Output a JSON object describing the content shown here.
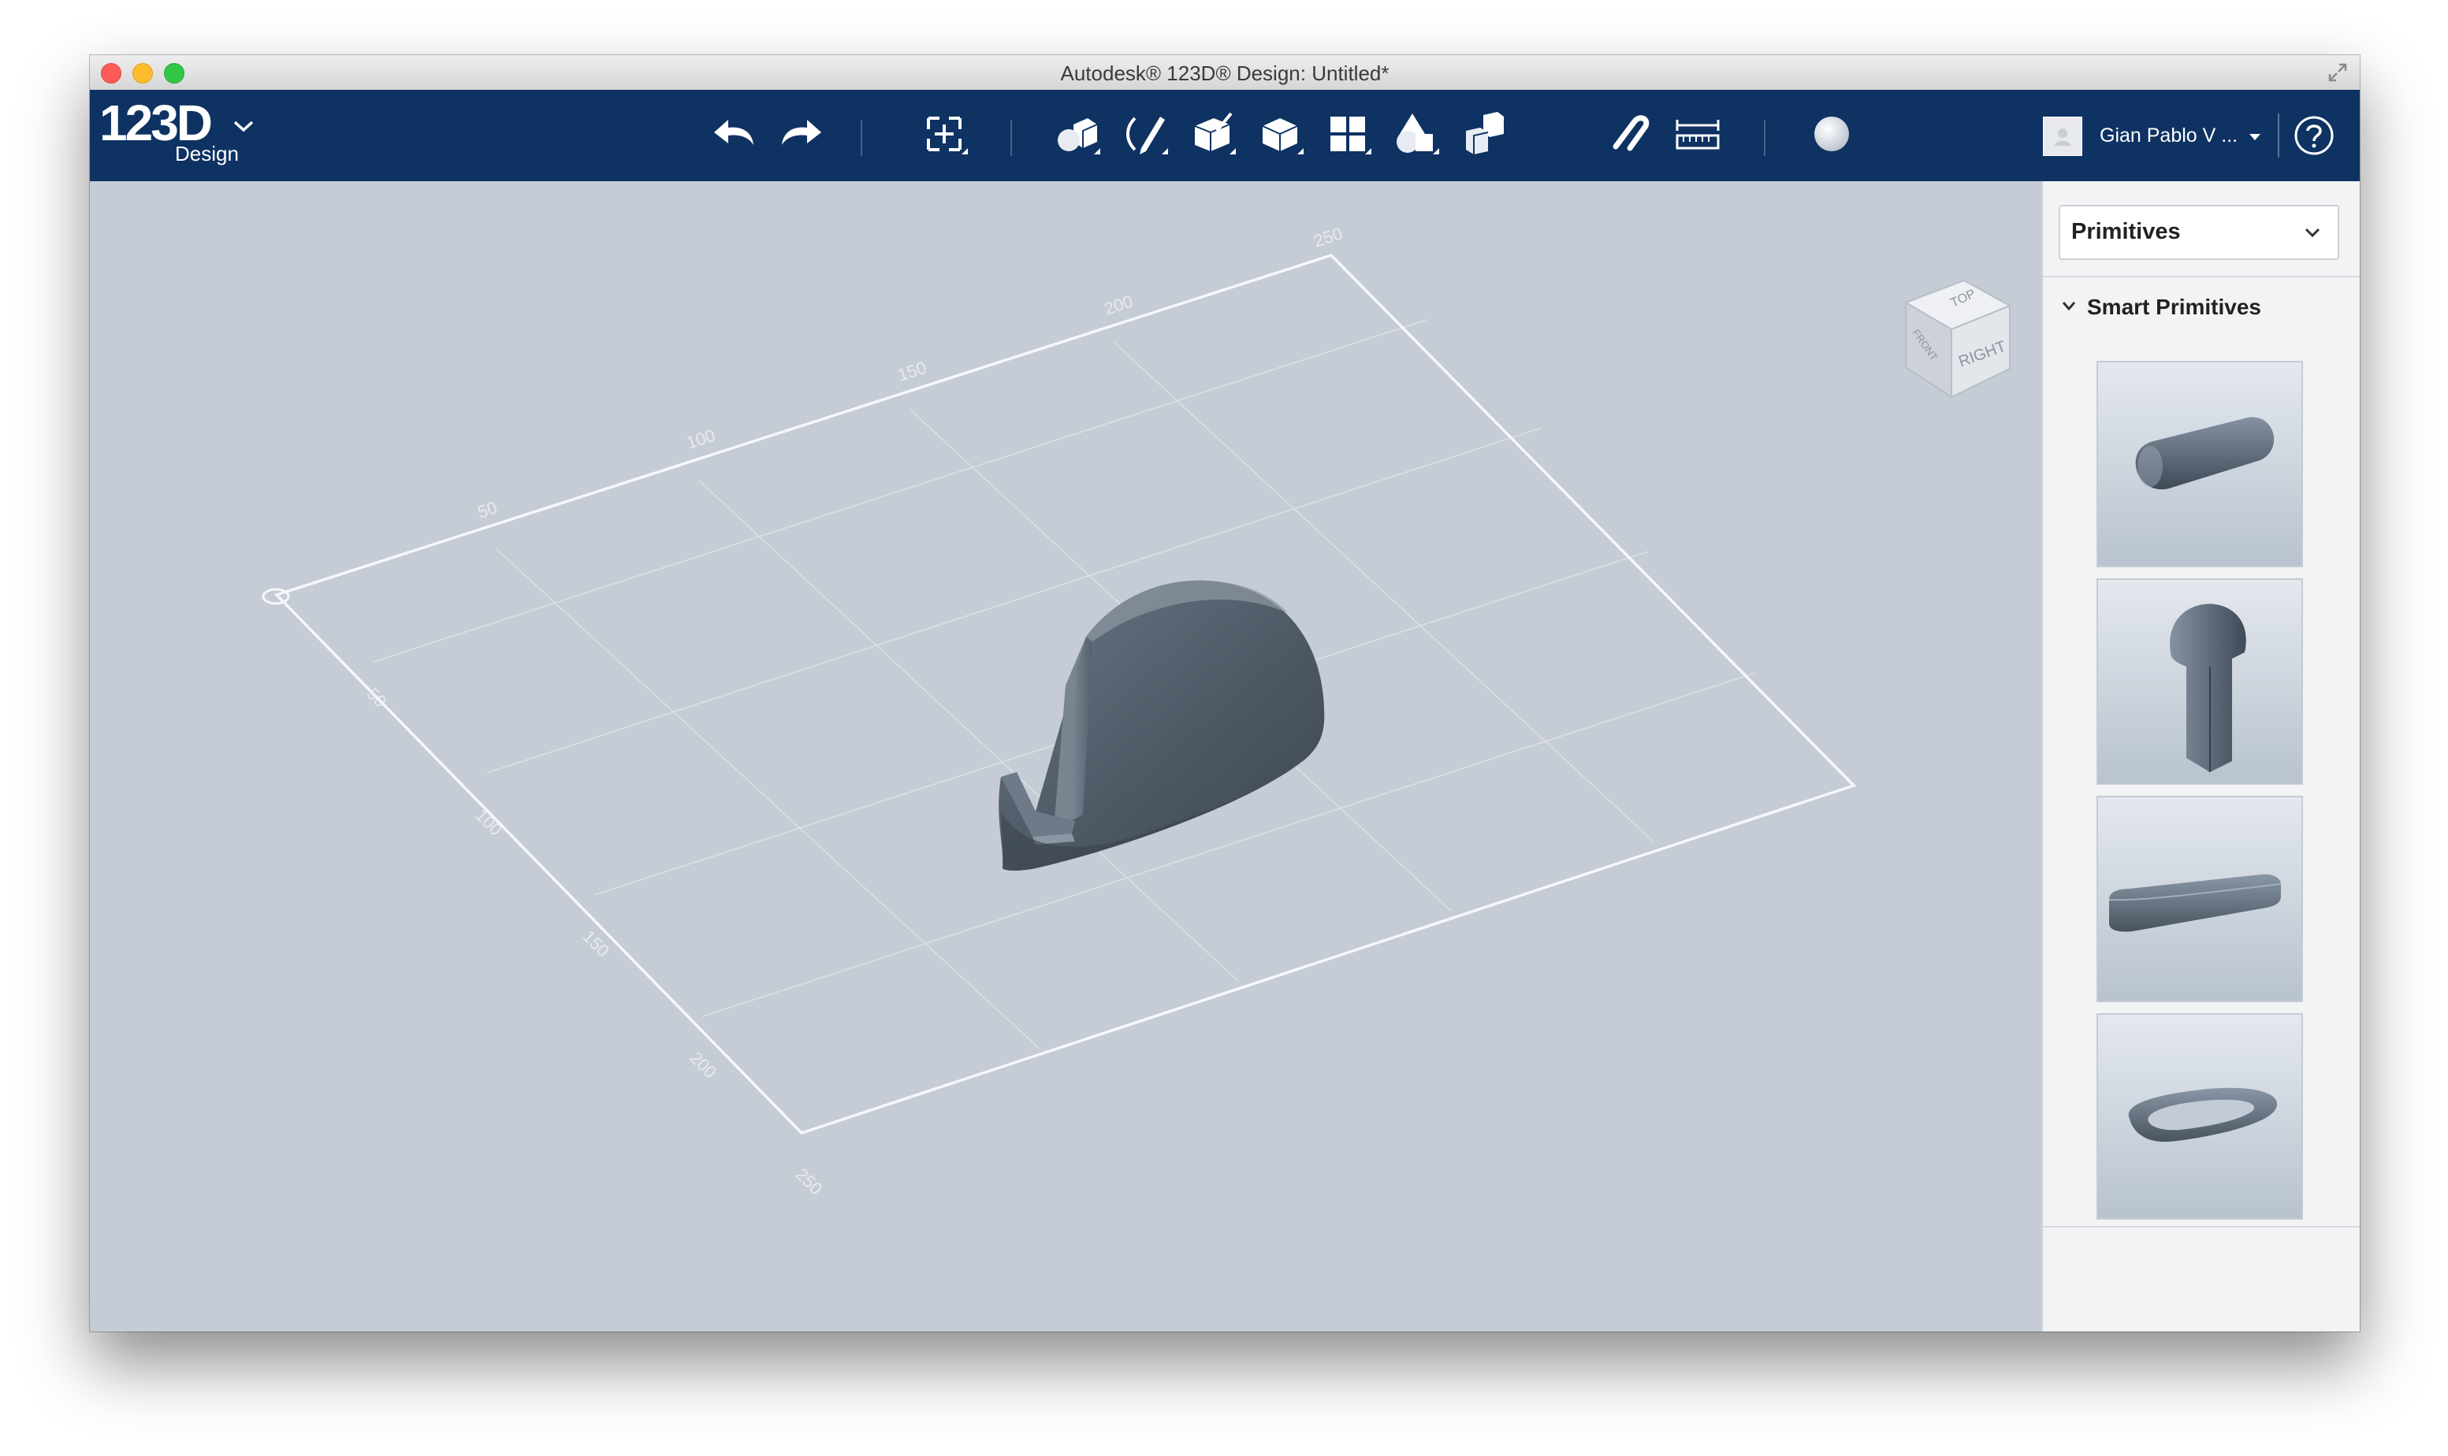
{
  "window": {
    "title": "Autodesk® 123D® Design: Untitled*"
  },
  "logo": {
    "main": "123D",
    "sub": "Design"
  },
  "toolbar": {
    "tools": [
      "undo-icon",
      "redo-icon",
      "transform-icon",
      "primitives-icon",
      "sketch-icon",
      "construct-icon",
      "modify-icon",
      "pattern-icon",
      "group-icon",
      "combine-icon",
      "snap-icon",
      "measure-icon",
      "material-icon"
    ]
  },
  "user": {
    "name": "Gian Pablo V ..."
  },
  "viewcube": {
    "top": "TOP",
    "right": "RIGHT",
    "front": "FRONT"
  },
  "grid": {
    "top_edge_labels": [
      "50",
      "100",
      "150",
      "200",
      "250"
    ],
    "left_edge_labels": [
      "50",
      "100",
      "150",
      "200",
      "250"
    ]
  },
  "panel": {
    "dropdown_value": "Primitives",
    "section_title": "Smart Primitives",
    "items": [
      "capsule-primitive",
      "keyhole-primitive",
      "slot-primitive",
      "ring-slot-primitive"
    ]
  },
  "colors": {
    "toolbar_bg": "#0e3262",
    "viewport_bg": "#c6ccd5",
    "model": "#4e5966"
  }
}
